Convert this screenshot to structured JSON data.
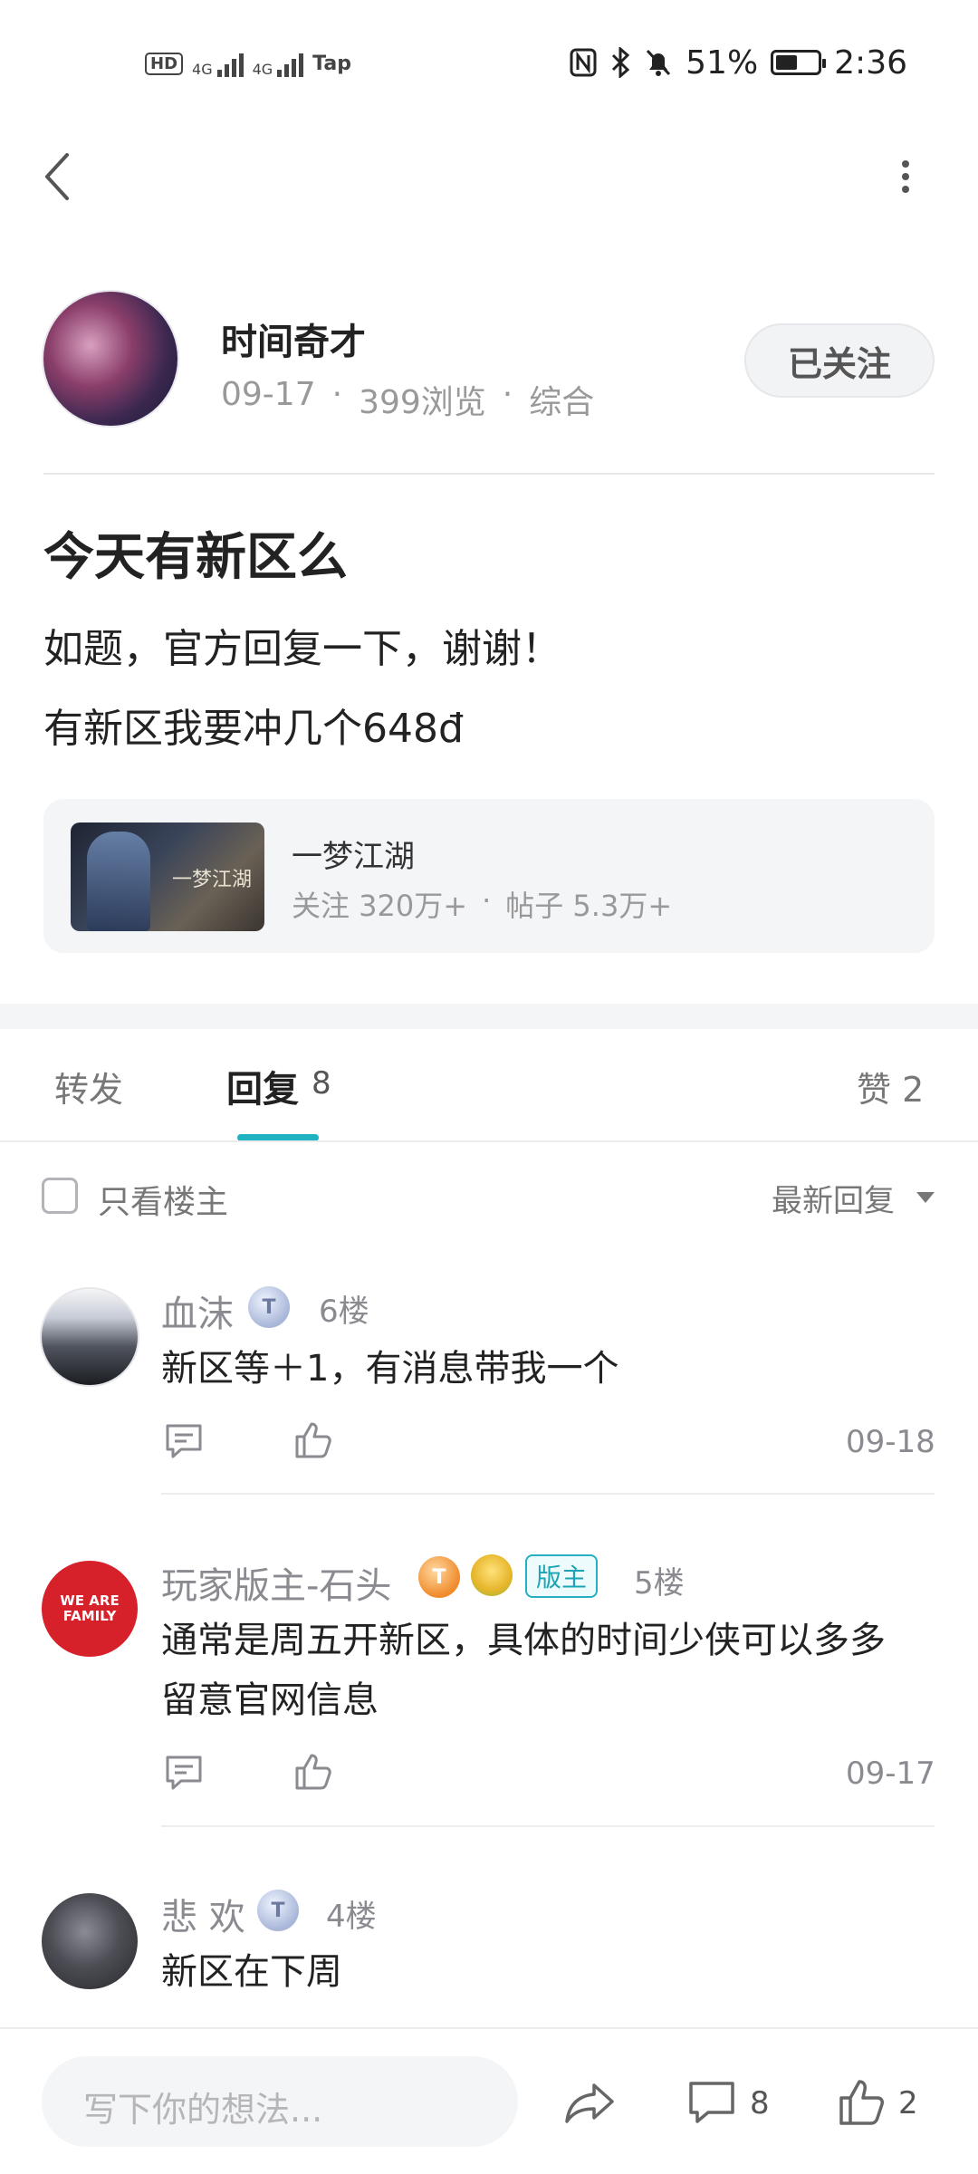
{
  "status_bar": {
    "hd_label": "HD",
    "sim1": "4G",
    "sim2": "4G",
    "extra": "Tap",
    "battery_text": "51%",
    "battery_level": 0.51,
    "time": "2:36"
  },
  "header": {
    "back_icon": "chevron-left-icon",
    "more_icon": "vertical-dots-icon"
  },
  "author": {
    "name": "时间奇才",
    "date": "09-17",
    "views": "399浏览",
    "category": "综合",
    "sep": "·",
    "follow_label": "已关注"
  },
  "post": {
    "title": "今天有新区么",
    "line1": "如题，官方回复一下，谢谢！",
    "line2": "有新区我要冲几个648đ"
  },
  "game": {
    "name": "一梦江湖",
    "thumb_text": "一梦江湖",
    "followers": "关注 320万+",
    "posts": "帖子 5.3万+",
    "sep": "·"
  },
  "tabs": {
    "forward": "转发",
    "reply": "回复",
    "reply_count": "8",
    "like": "赞 2"
  },
  "filter": {
    "only_op": "只看楼主",
    "sort": "最新回复"
  },
  "replies": [
    {
      "name": "血沫",
      "badge": "T",
      "floor": "6楼",
      "text": "新区等＋1，有消息带我一个",
      "date": "09-18"
    },
    {
      "name": "玩家版主-石头",
      "badge": "T",
      "mod_tag": "版主",
      "floor": "5楼",
      "text_line1": "通常是周五开新区，具体的时间少侠可以多多",
      "text_line2": "留意官网信息",
      "date": "09-17",
      "avatar_text": "WE ARE FAMILY"
    },
    {
      "name": "悲 欢",
      "badge": "T",
      "floor": "4楼",
      "text": "新区在下周"
    }
  ],
  "bottom": {
    "placeholder": "写下你的想法...",
    "comment_count": "8",
    "like_count": "2"
  },
  "colors": {
    "accent": "#1fb2c0",
    "mod_tag": "#1aa4b6"
  }
}
